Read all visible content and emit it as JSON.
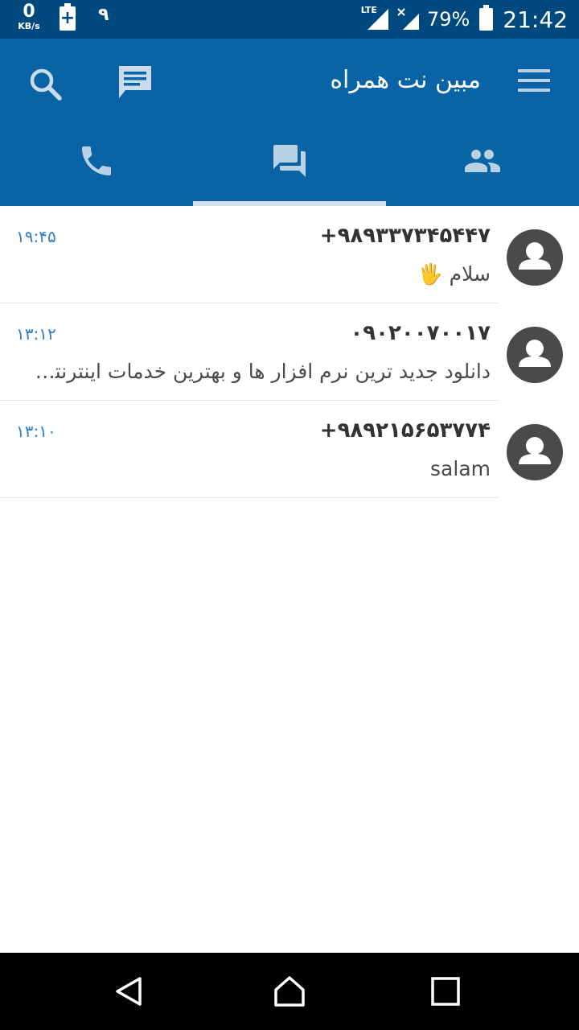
{
  "status_bar": {
    "speed_value": "0",
    "speed_unit": "KB/s",
    "notification_digit": "۹",
    "network_type": "LTE",
    "battery_percent": "79%",
    "time": "21:42"
  },
  "app_bar": {
    "title": "مبین نت همراه",
    "icons": [
      "search-icon",
      "compose-message-icon",
      "menu-icon"
    ],
    "tabs": [
      {
        "icon": "phone-icon",
        "active": false
      },
      {
        "icon": "chat-icon",
        "active": true
      },
      {
        "icon": "contacts-icon",
        "active": false
      }
    ]
  },
  "conversations": [
    {
      "number": "+۹۸۹۳۳۷۳۴۵۴۴۷",
      "preview": "سلام",
      "emoji": "🖐",
      "time": "۱۹:۴۵"
    },
    {
      "number": "۰۹۰۲۰۰۷۰۰۱۷",
      "preview": "دانلود جدید ترین نرم افزار ها و بهترین خدمات اینترنتی...",
      "time": "۱۳:۱۲"
    },
    {
      "number": "+۹۸۹۲۱۵۶۵۳۷۷۴",
      "preview": "salam",
      "time": "۱۳:۱۰"
    }
  ],
  "colors": {
    "status_bar": "#00497f",
    "app_bar": "#0963a4",
    "time_text": "#2d7fc2",
    "avatar": "#4a4a4a"
  }
}
